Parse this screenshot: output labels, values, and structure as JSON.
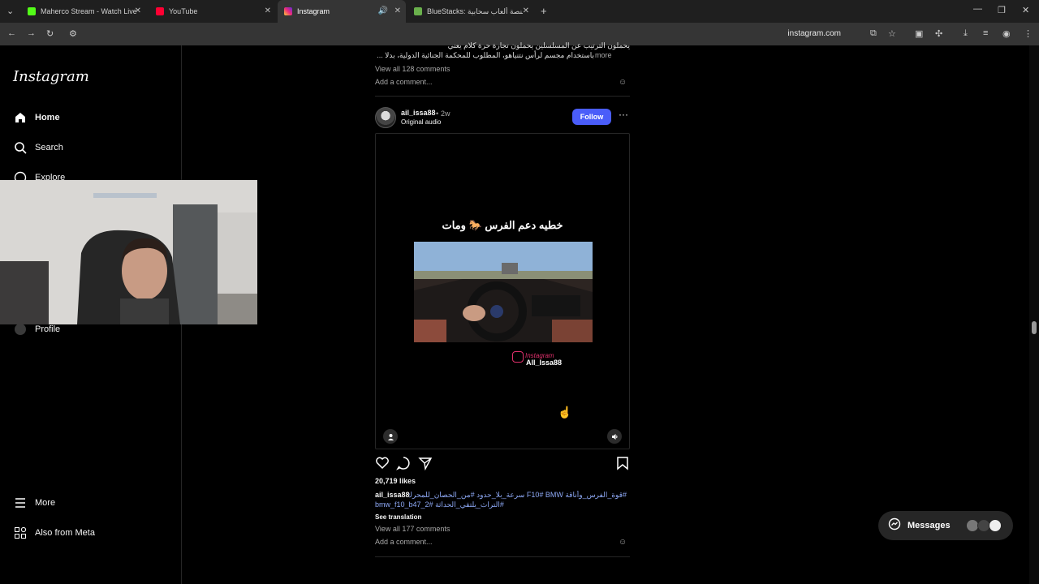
{
  "browser": {
    "tabs": [
      {
        "label": "Maherco Stream - Watch Live o",
        "color": "#53fc18"
      },
      {
        "label": "YouTube",
        "color": "#ff0033"
      },
      {
        "label": "Instagram",
        "color": "#e1306c"
      },
      {
        "label": "BlueStacks: منصة ألعاب سحابية",
        "color": "#6ab04c"
      }
    ],
    "url": "instagram.com"
  },
  "sidebar": {
    "logo": "Instagram",
    "items": [
      {
        "label": "Home",
        "icon": "home-icon"
      },
      {
        "label": "Search",
        "icon": "search-icon"
      },
      {
        "label": "Explore",
        "icon": "compass-icon"
      },
      {
        "label": "Profile",
        "icon": "profile-icon"
      },
      {
        "label": "More",
        "icon": "menu-icon"
      },
      {
        "label": "Also from Meta",
        "icon": "meta-icon"
      }
    ]
  },
  "prev_post": {
    "caption_line1": "يحملون الترتيب عن المسلسلين يحملون تجارة حرة كلام يعني",
    "caption_line2": "باستخدام مجسم لرأس نتنياهو، المطلوب للمحكمة الجنائية الدولية، بدلا ...",
    "more": "more",
    "view_comments": "View all 128 comments",
    "add_comment": "Add a comment..."
  },
  "post": {
    "username": "ail_issa88",
    "time": "2w",
    "audio": "Original audio",
    "follow": "Follow",
    "media_title": "خطيه دعم الفرس 🐎 ومات",
    "watermark_brand": "Instagram",
    "watermark_user": "All_Issa88",
    "likes": "20,719 likes",
    "caption_user": "ail_issa88",
    "caption_tags_1": "#قوة_الفرس_وأناقة F10# BMW سرعة_بلا_حدود #من_الحصان_للمحرك#",
    "caption_tags_2": "bmw_f10_b47_2# التراث_يلتقي_الحداثة#",
    "see_translation": "See translation",
    "view_comments": "View all 177 comments",
    "add_comment": "Add a comment..."
  },
  "messages": {
    "label": "Messages"
  }
}
